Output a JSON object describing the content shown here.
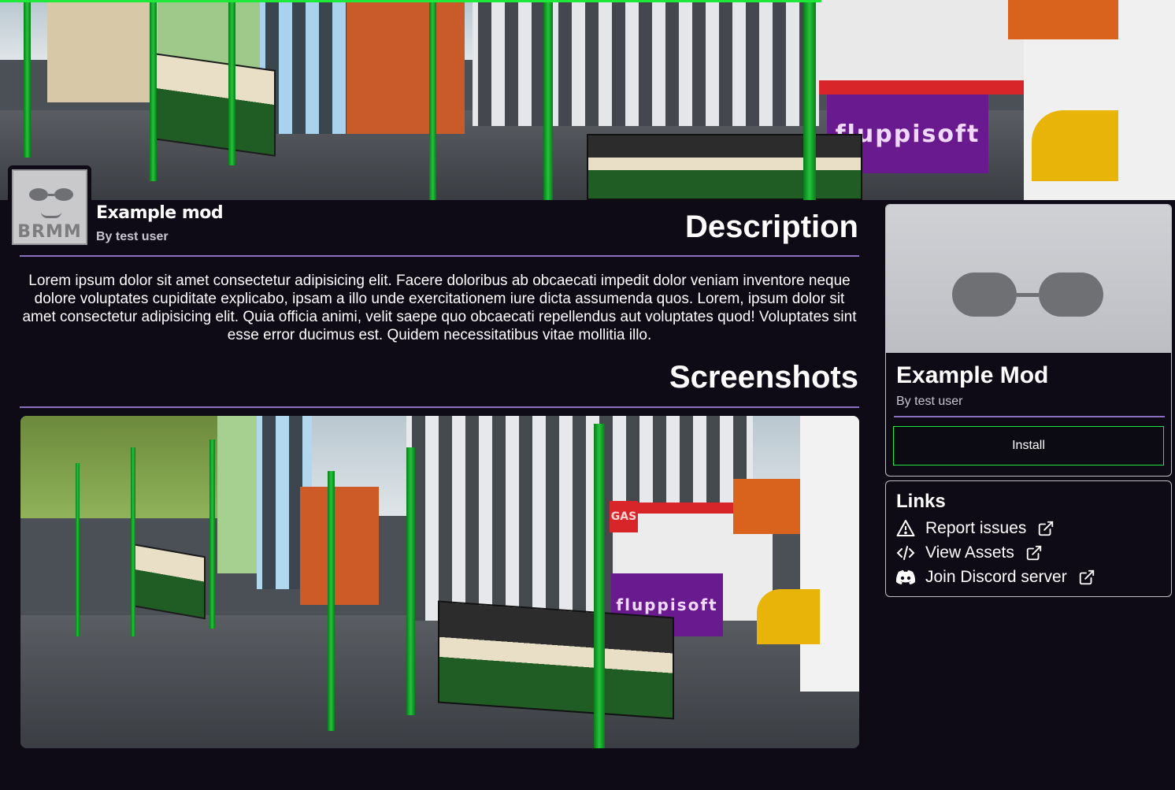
{
  "header": {
    "mod_title": "Example mod",
    "mod_author": "By test user",
    "icon_text": "BRMM"
  },
  "description": {
    "title": "Description",
    "text": "Lorem ipsum dolor sit amet consectetur adipisicing elit. Facere doloribus ab obcaecati impedit dolor veniam inventore neque dolore voluptates cupiditate explicabo, ipsam a illo unde exercitationem iure dicta assumenda quos. Lorem, ipsum dolor sit amet consectetur adipisicing elit. Quia officia animi, velit saepe quo obcaecati repellendus aut voluptates quod! Voluptates sint esse error ducimus est. Quidem necessitatibus vitae mollitia illo."
  },
  "screenshots": {
    "title": "Screenshots",
    "billboard_text": "fluppisoft",
    "gas_sign": "GAS"
  },
  "card": {
    "title": "Example Mod",
    "author": "By test user",
    "install_label": "Install"
  },
  "links": {
    "title": "Links",
    "items": [
      {
        "label": "Report issues",
        "icon": "warning-icon"
      },
      {
        "label": "View Assets",
        "icon": "code-icon"
      },
      {
        "label": "Join Discord server",
        "icon": "discord-icon"
      }
    ]
  },
  "colors": {
    "background": "#0f0b16",
    "accent_divider": "#8a6fc4",
    "install_border": "#1ee83a",
    "progress": "#1ee83a"
  }
}
